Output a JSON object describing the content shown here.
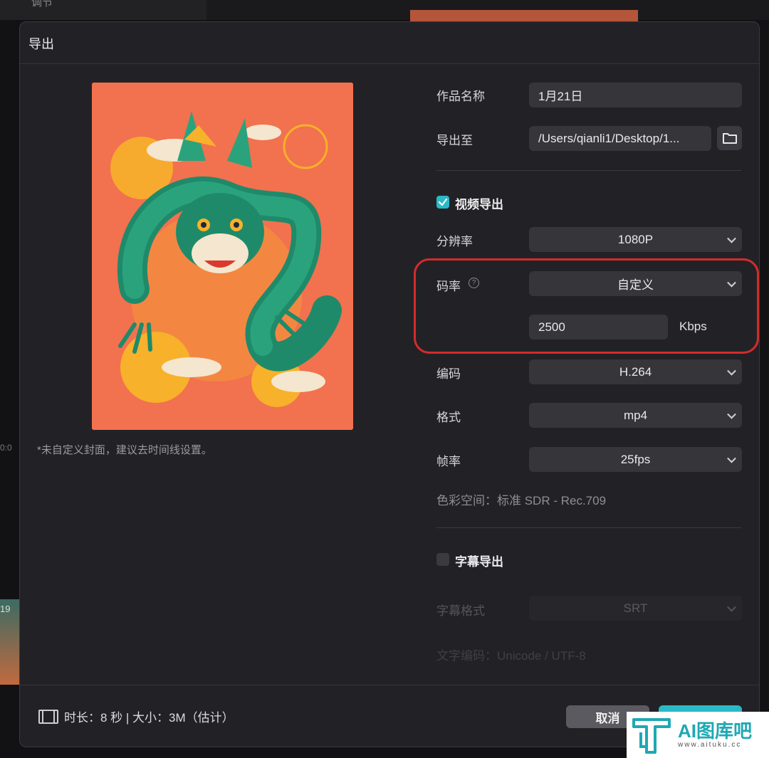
{
  "background": {
    "top_label": "调节",
    "thumb_label": "19",
    "time_label": "0:0"
  },
  "dialog": {
    "title": "导出",
    "cover_note": "*未自定义封面，建议去时间线设置。",
    "form": {
      "work_name_label": "作品名称",
      "work_name_value": "1月21日",
      "export_to_label": "导出至",
      "export_to_value": "/Users/qianli1/Desktop/1...",
      "video_export_label": "视频导出",
      "video_export_checked": true,
      "resolution_label": "分辨率",
      "resolution_value": "1080P",
      "bitrate_label": "码率",
      "bitrate_value": "自定义",
      "bitrate_custom_value": "2500",
      "bitrate_unit": "Kbps",
      "codec_label": "编码",
      "codec_value": "H.264",
      "format_label": "格式",
      "format_value": "mp4",
      "framerate_label": "帧率",
      "framerate_value": "25fps",
      "color_space": "色彩空间：标准 SDR - Rec.709",
      "subtitle_export_label": "字幕导出",
      "subtitle_export_checked": false,
      "subtitle_format_label": "字幕格式",
      "subtitle_format_value": "SRT",
      "text_encoding": "文字编码：Unicode / UTF-8"
    },
    "footer": {
      "info": "时长：8 秒 | 大小：3M（估计）",
      "cancel_label": "取消",
      "export_label": "导出"
    }
  },
  "watermark": {
    "brand": "AI图库吧",
    "url": "www.aituku.cc"
  },
  "colors": {
    "accent": "#2ab9c7",
    "highlight": "#d42b2b",
    "cover_bg": "#f2714f"
  }
}
